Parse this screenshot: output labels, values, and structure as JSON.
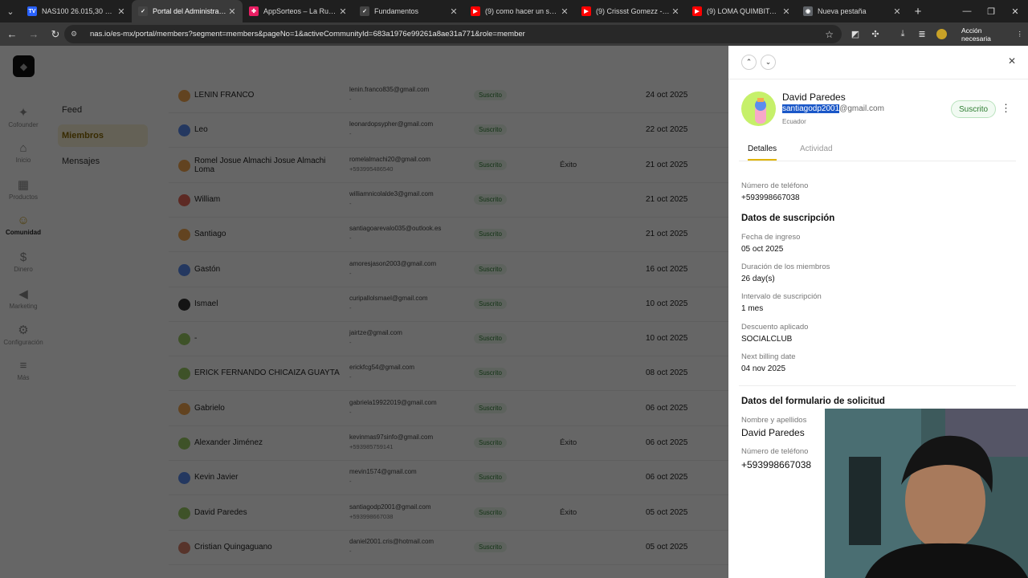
{
  "browser": {
    "tabs": [
      {
        "label": "NAS100 26.015,30 ▲ +0.0…",
        "icon": "tradingview-icon",
        "color": "#2962ff",
        "glyph": "TV"
      },
      {
        "label": "Portal del Administrador de…",
        "icon": "nas-io-icon",
        "color": "#444444",
        "glyph": "✓",
        "active": true
      },
      {
        "label": "AppSorteos – La Ruleta de…",
        "icon": "appsorteos-icon",
        "color": "#e91e63",
        "glyph": "✤"
      },
      {
        "label": "Fundamentos",
        "icon": "nas-io-icon",
        "color": "#444444",
        "glyph": "✓"
      },
      {
        "label": "(9) como hacer un sorteo…",
        "icon": "youtube-icon",
        "color": "#ff0000",
        "glyph": "▶"
      },
      {
        "label": "(9) Crissst Gomezz - YouT…",
        "icon": "youtube-icon",
        "color": "#ff0000",
        "glyph": "▶"
      },
      {
        "label": "(9) LOMA QUIMBITA CRIS…",
        "icon": "youtube-icon",
        "color": "#ff0000",
        "glyph": "▶"
      },
      {
        "label": "Nueva pestaña",
        "icon": "chrome-icon",
        "color": "#5f6368",
        "glyph": "◉"
      }
    ],
    "url": "nas.io/es-mx/portal/members?segment=members&pageNo=1&activeCommunityId=683a1976e99261a8ae31a771&role=member",
    "action_button": "Acción necesaria"
  },
  "rail": [
    {
      "label": "Cofounder",
      "icon": "sparkle-icon",
      "glyph": "✦"
    },
    {
      "label": "Inicio",
      "icon": "home-icon",
      "glyph": "⌂"
    },
    {
      "label": "Productos",
      "icon": "grid-icon",
      "glyph": "▦"
    },
    {
      "label": "Comunidad",
      "icon": "community-icon",
      "glyph": "☺",
      "active": true
    },
    {
      "label": "Dinero",
      "icon": "money-icon",
      "glyph": "$"
    },
    {
      "label": "Marketing",
      "icon": "megaphone-icon",
      "glyph": "◀"
    },
    {
      "label": "Configuración",
      "icon": "gear-icon",
      "glyph": "⚙"
    },
    {
      "label": "Más",
      "icon": "menu-icon",
      "glyph": "≡"
    }
  ],
  "subnav": [
    {
      "label": "Feed"
    },
    {
      "label": "Miembros",
      "active": true
    },
    {
      "label": "Mensajes"
    }
  ],
  "members": [
    {
      "name": "LENIN FRANCO",
      "email": "lenin.franco835@gmail.com",
      "phone": "-",
      "status": "Suscrito",
      "result": "",
      "date": "24 oct 2025",
      "avatar": "#f4a950"
    },
    {
      "name": "Leo",
      "email": "leonardopsypher@gmail.com",
      "phone": "-",
      "status": "Suscrito",
      "result": "",
      "date": "22 oct 2025",
      "avatar": "#5b8def"
    },
    {
      "name": "Romel Josue Almachi Josue Almachi Loma",
      "email": "romelalmachi20@gmail.com",
      "phone": "+593995486540",
      "status": "Suscrito",
      "result": "Éxito",
      "date": "21 oct 2025",
      "avatar": "#f4a950"
    },
    {
      "name": "William",
      "email": "williamnicolalde3@gmail.com",
      "phone": "-",
      "status": "Suscrito",
      "result": "",
      "date": "21 oct 2025",
      "avatar": "#e86a5a"
    },
    {
      "name": "Santiago",
      "email": "santiagoarevalo035@outlook.es",
      "phone": "-",
      "status": "Suscrito",
      "result": "",
      "date": "21 oct 2025",
      "avatar": "#f4a950"
    },
    {
      "name": "Gastón",
      "email": "amoresjason2003@gmail.com",
      "phone": "-",
      "status": "Suscrito",
      "result": "",
      "date": "16 oct 2025",
      "avatar": "#5b8def"
    },
    {
      "name": "Ismael",
      "email": "curipallolsmael@gmail.com",
      "phone": "-",
      "status": "Suscrito",
      "result": "",
      "date": "10 oct 2025",
      "avatar": "#333333"
    },
    {
      "name": "-",
      "email": "jairtze@gmail.com",
      "phone": "-",
      "status": "Suscrito",
      "result": "",
      "date": "10 oct 2025",
      "avatar": "#9ccc65"
    },
    {
      "name": "ERICK FERNANDO CHICAIZA GUAYTA",
      "email": "erickfcg54@gmail.com",
      "phone": "-",
      "status": "Suscrito",
      "result": "",
      "date": "08 oct 2025",
      "avatar": "#9ccc65"
    },
    {
      "name": "Gabrielo",
      "email": "gabriela19922019@gmail.com",
      "phone": "-",
      "status": "Suscrito",
      "result": "",
      "date": "06 oct 2025",
      "avatar": "#f4a950"
    },
    {
      "name": "Alexander Jiménez",
      "email": "kevinmas97sinfo@gmail.com",
      "phone": "+593985759141",
      "status": "Suscrito",
      "result": "Éxito",
      "date": "06 oct 2025",
      "avatar": "#9ccc65"
    },
    {
      "name": "Kevin Javier",
      "email": "mevin1574@gmail.com",
      "phone": "-",
      "status": "Suscrito",
      "result": "",
      "date": "06 oct 2025",
      "avatar": "#5b8def"
    },
    {
      "name": "David Paredes",
      "email": "santiagodp2001@gmail.com",
      "phone": "+593998667038",
      "status": "Suscrito",
      "result": "Éxito",
      "date": "05 oct 2025",
      "avatar": "#9ccc65"
    },
    {
      "name": "Cristian Quingaguano",
      "email": "daniel2001.cris@hotmail.com",
      "phone": "-",
      "status": "Suscrito",
      "result": "",
      "date": "05 oct 2025",
      "avatar": "#d9826b"
    }
  ],
  "drawer": {
    "name": "David Paredes",
    "email_selected": "santiagodp2001",
    "email_rest": "@gmail.com",
    "country": "Ecuador",
    "status": "Suscrito",
    "tabs": {
      "details": "Detalles",
      "activity": "Actividad"
    },
    "phone_label": "Número de teléfono",
    "phone_value": "+593998667038",
    "subscription_title": "Datos de suscripción",
    "join_label": "Fecha de ingreso",
    "join_value": "05 oct 2025",
    "duration_label": "Duración de los miembros",
    "duration_value": "26 day(s)",
    "interval_label": "Intervalo de suscripción",
    "interval_value": "1 mes",
    "discount_label": "Descuento aplicado",
    "discount_value": "SOCIALCLUB",
    "billing_label": "Next billing date",
    "billing_value": "04 nov 2025",
    "form_title": "Datos del formulario de solicitud",
    "fullname_label": "Nombre y apellidos",
    "fullname_value": "David Paredes",
    "form_phone_label": "Número de teléfono",
    "form_phone_value": "+593998667038"
  }
}
